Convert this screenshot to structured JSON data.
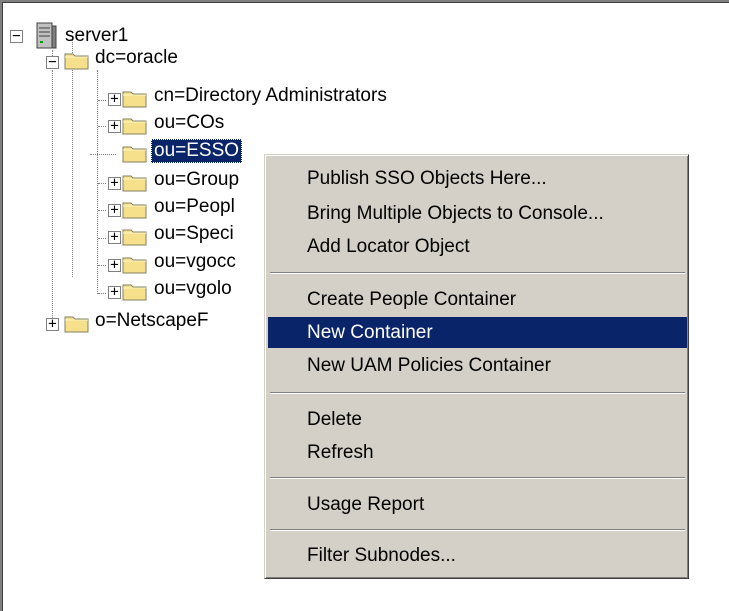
{
  "tree": {
    "root": {
      "label": "server1",
      "icon": "server-icon",
      "expanded": true
    },
    "nodes": [
      {
        "label": "dc=oracle",
        "expanded": true
      },
      {
        "label": "cn=Directory Administrators",
        "expanded": false
      },
      {
        "label": "ou=COs",
        "expanded": false
      },
      {
        "label": "ou=ESSO",
        "selected": true
      },
      {
        "label": "ou=Group",
        "expanded": false
      },
      {
        "label": "ou=Peopl",
        "expanded": false
      },
      {
        "label": "ou=Speci",
        "expanded": false
      },
      {
        "label": "ou=vgocc",
        "expanded": false
      },
      {
        "label": "ou=vgolo",
        "expanded": false
      },
      {
        "label": "o=NetscapeF",
        "expanded": false
      }
    ],
    "colors": {
      "selection": "#0a246a",
      "folder": "#f7e08c"
    }
  },
  "context_menu": {
    "items": [
      {
        "label": "Publish SSO Objects Here..."
      },
      {
        "label": "Bring Multiple Objects to Console..."
      },
      {
        "label": "Add Locator Object"
      },
      {
        "label": "Create People Container"
      },
      {
        "label": "New Container",
        "highlighted": true
      },
      {
        "label": "New UAM Policies Container"
      },
      {
        "label": "Delete"
      },
      {
        "label": "Refresh"
      },
      {
        "label": "Usage Report"
      },
      {
        "label": "Filter Subnodes..."
      }
    ],
    "colors": {
      "background": "#d4d0c8",
      "highlight": "#0a246a"
    }
  }
}
